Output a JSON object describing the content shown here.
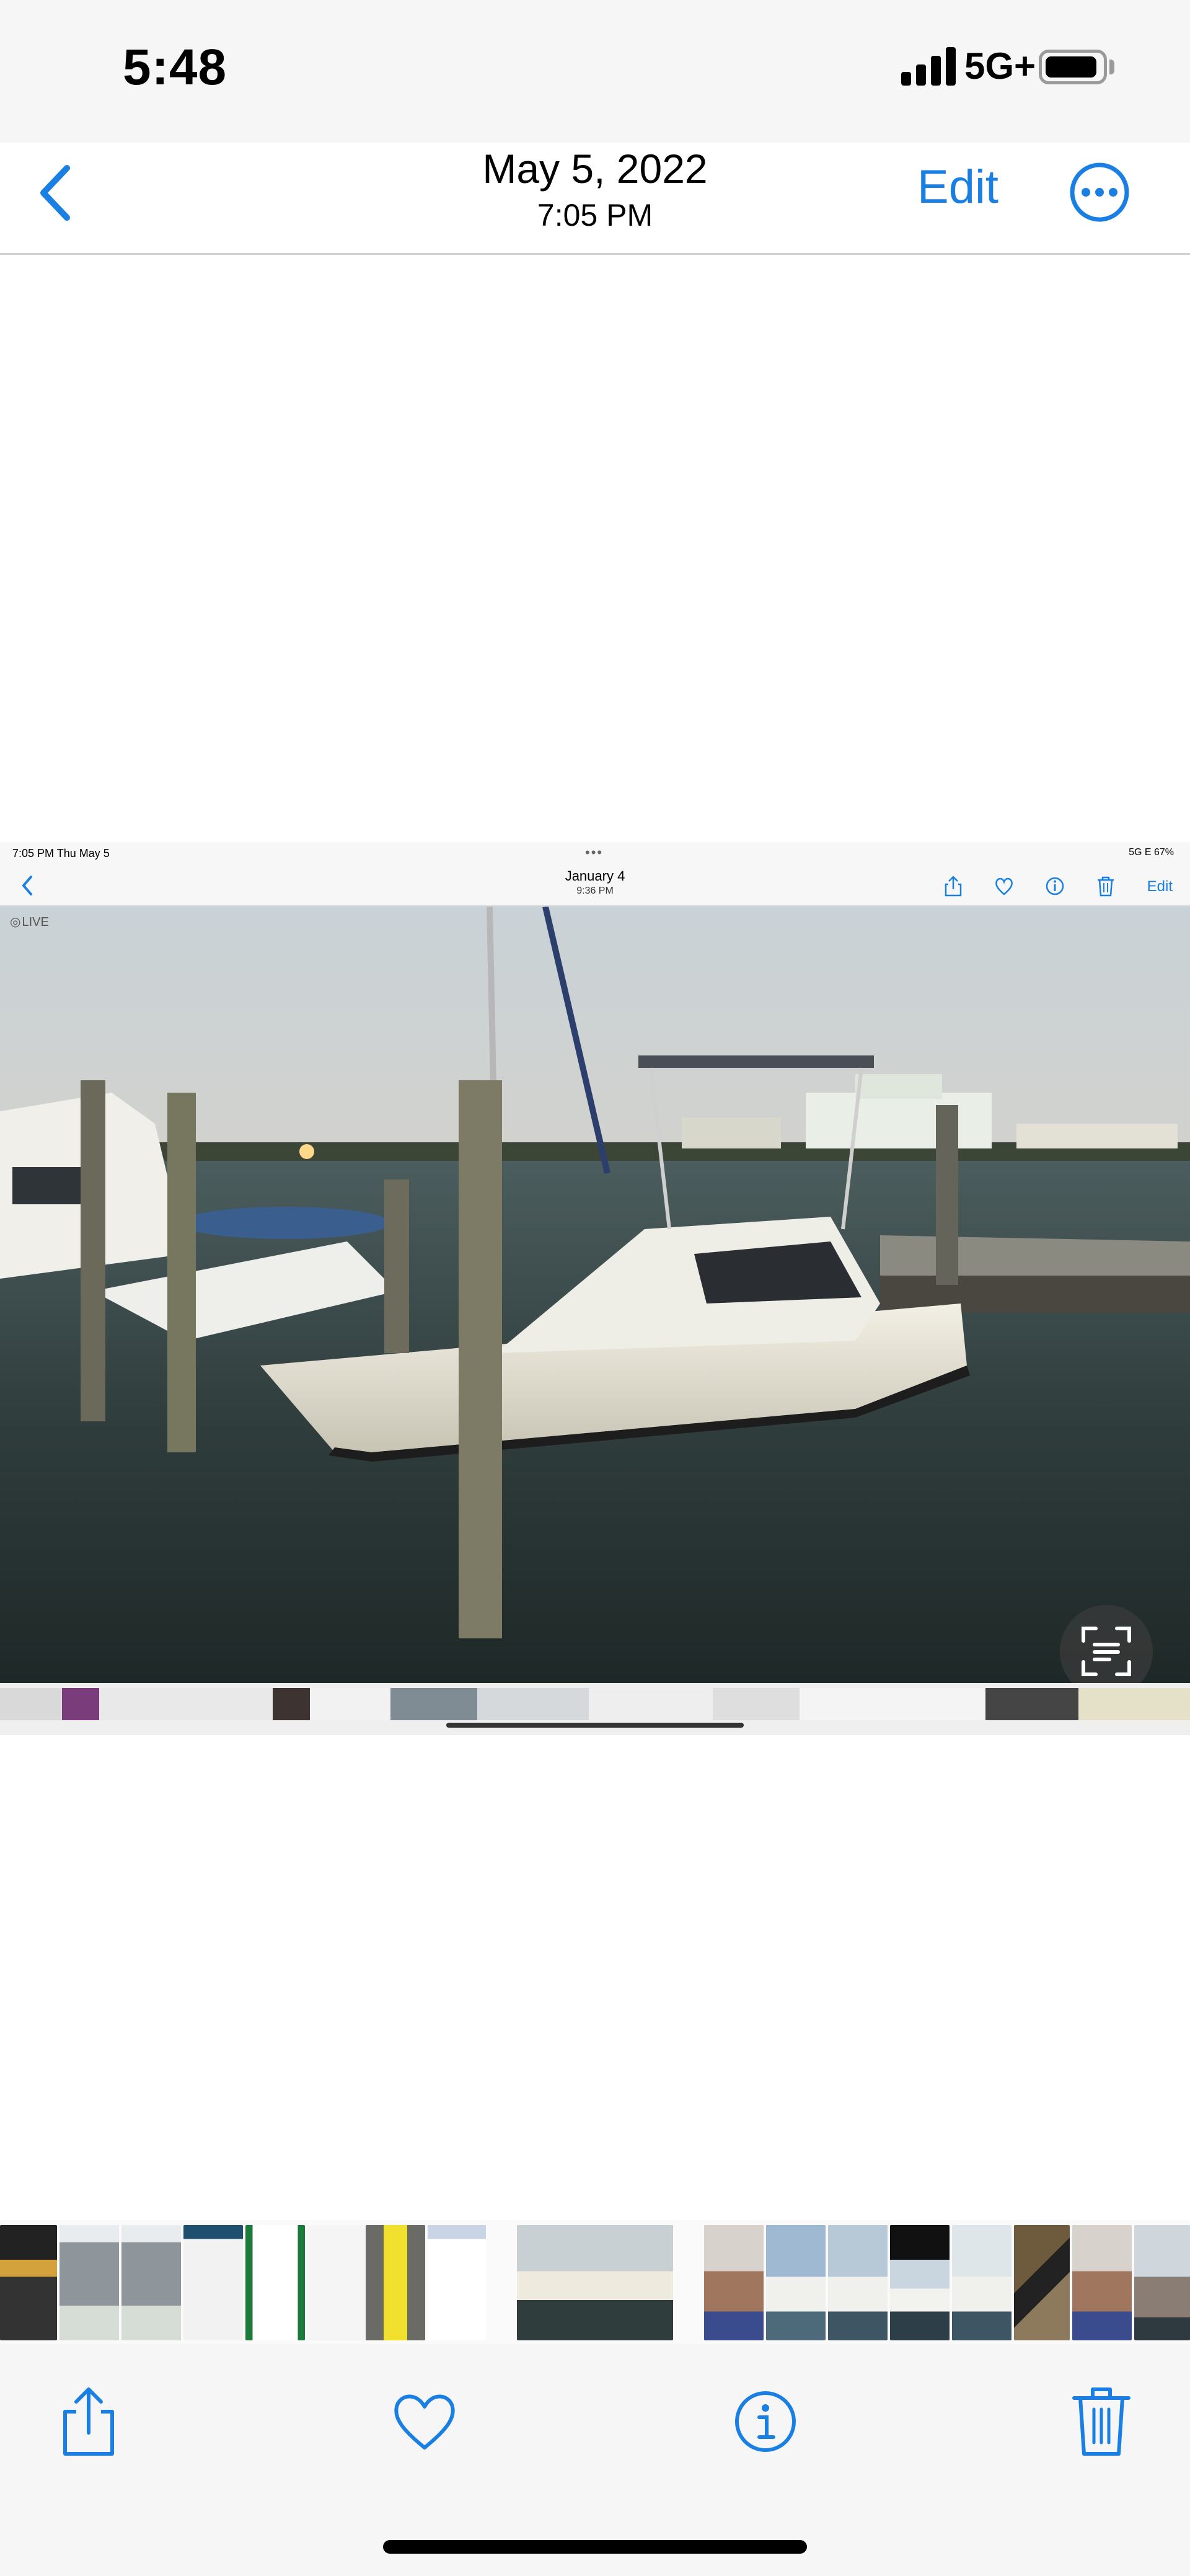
{
  "status_bar": {
    "time": "5:48",
    "network": "5G+",
    "battery_level": 0.85
  },
  "nav": {
    "back_icon": "chevron-left-icon",
    "date": "May 5, 2022",
    "time": "7:05 PM",
    "edit_label": "Edit",
    "more_icon": "ellipsis-circle-icon"
  },
  "embedded_screenshot": {
    "status_time": "7:05 PM   Thu May 5",
    "status_right": "5G E 67%",
    "nav_date": "January 4",
    "nav_time": "9:36 PM",
    "edit_label": "Edit",
    "live_label": "LIVE",
    "icons": [
      "share-icon",
      "heart-icon",
      "info-icon",
      "trash-icon"
    ]
  },
  "toolbar": {
    "icons": [
      "share-icon",
      "heart-icon",
      "info-icon",
      "trash-icon"
    ]
  },
  "colors": {
    "accent": "#1a7fe3",
    "bar_background": "#f6f6f6"
  }
}
